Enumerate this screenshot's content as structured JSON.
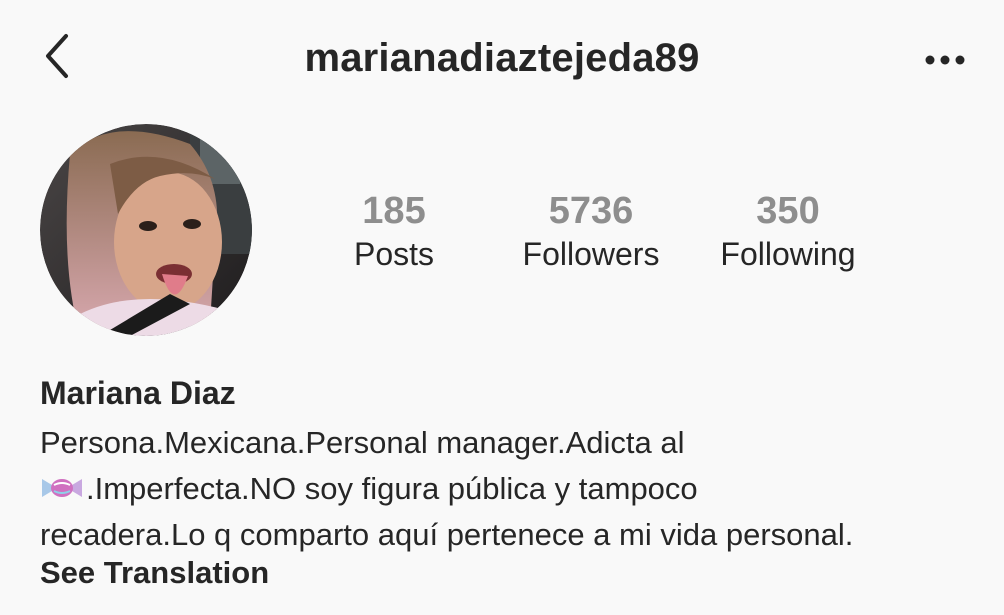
{
  "header": {
    "username": "marianadiaztejeda89",
    "back_icon": "chevron-left-icon",
    "more_icon": "more-horizontal-icon"
  },
  "stats": {
    "posts_count": "185",
    "posts_label": "Posts",
    "followers_count": "5736",
    "followers_label": "Followers",
    "following_count": "350",
    "following_label": "Following"
  },
  "profile": {
    "full_name": "Mariana Diaz",
    "bio_line1": "Persona.Mexicana.Personal manager.Adicta al",
    "bio_line2_emoji": "candy-icon",
    "bio_line2": ".Imperfecta.NO soy figura pública y tampoco",
    "bio_line3": "recadera.Lo q comparto aquí pertenece a mi vida personal.",
    "see_translation": "See Translation"
  },
  "colors": {
    "background": "#f9f9f9",
    "text": "#262626",
    "stat_number": "#8e8e8e"
  }
}
